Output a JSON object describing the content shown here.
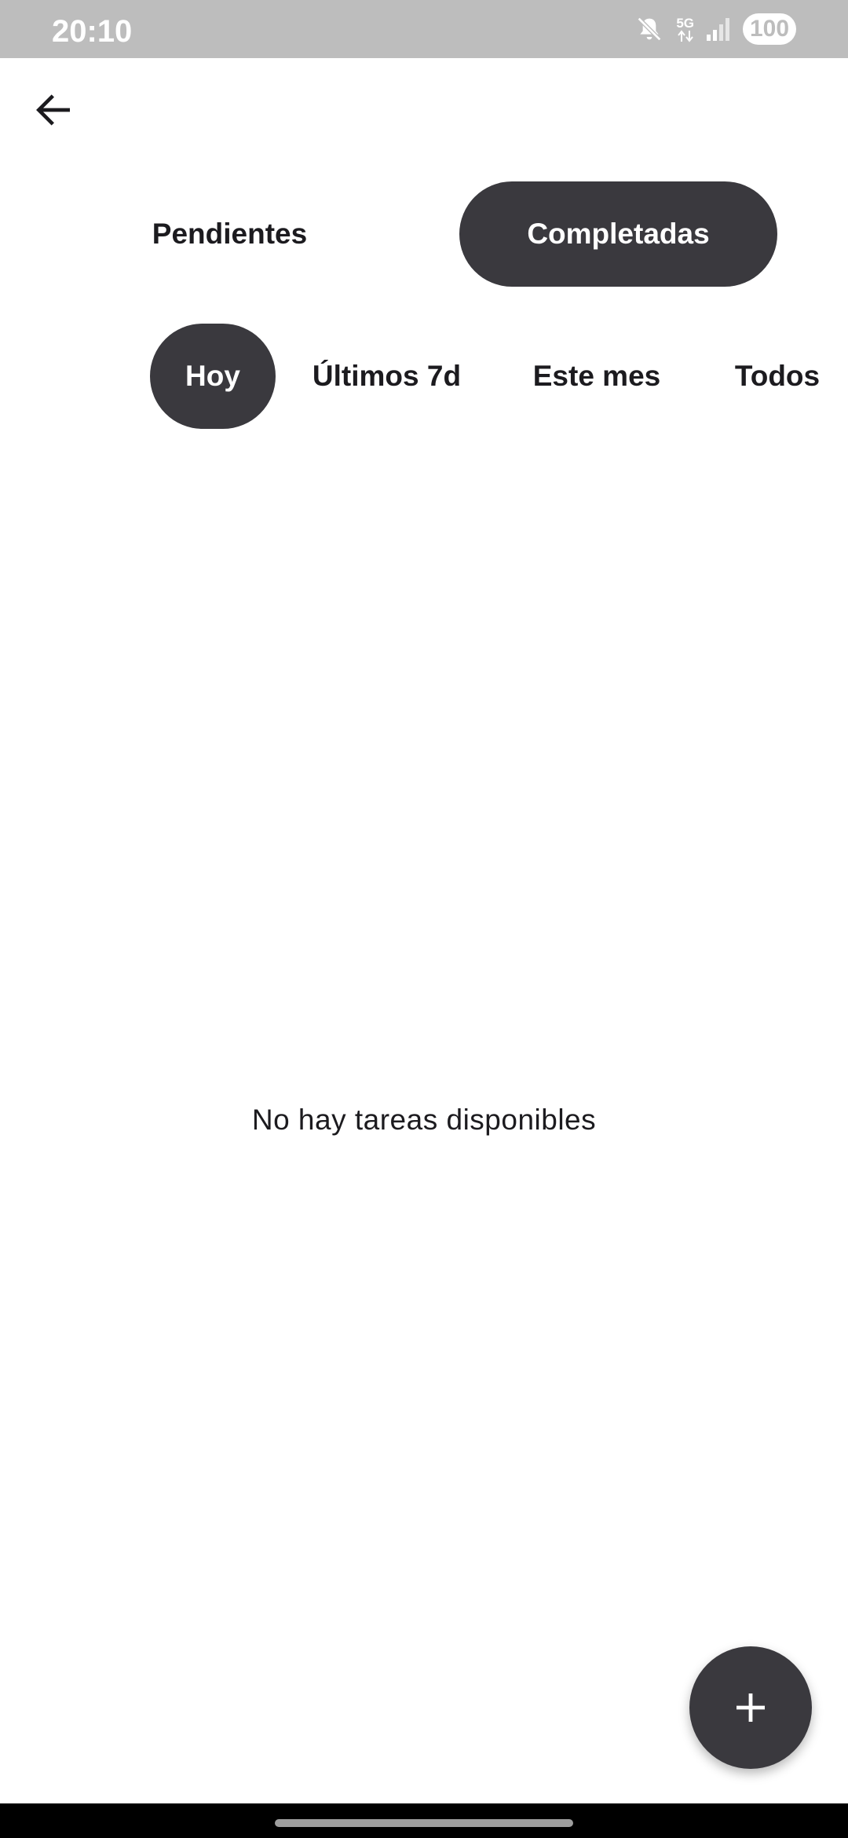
{
  "status_bar": {
    "time": "20:10",
    "network": "5G",
    "battery": "100",
    "icons": [
      "mute-icon",
      "data-arrows-icon",
      "signal-icon",
      "battery-icon"
    ]
  },
  "toolbar": {
    "back_icon": "arrow-left-icon"
  },
  "tabs": [
    {
      "label": "Pendientes",
      "selected": false
    },
    {
      "label": "Completadas",
      "selected": true
    }
  ],
  "filters": [
    {
      "label": "Hoy",
      "selected": true
    },
    {
      "label": "Últimos 7d",
      "selected": false
    },
    {
      "label": "Este mes",
      "selected": false
    },
    {
      "label": "Todos",
      "selected": false
    }
  ],
  "empty_state": {
    "message": "No hay tareas disponibles"
  },
  "fab": {
    "icon": "plus-icon"
  },
  "colors": {
    "accent": "#3a393e",
    "status_bar": "#bdbdbd",
    "background": "#ffffff",
    "text": "#1c1b1f"
  }
}
